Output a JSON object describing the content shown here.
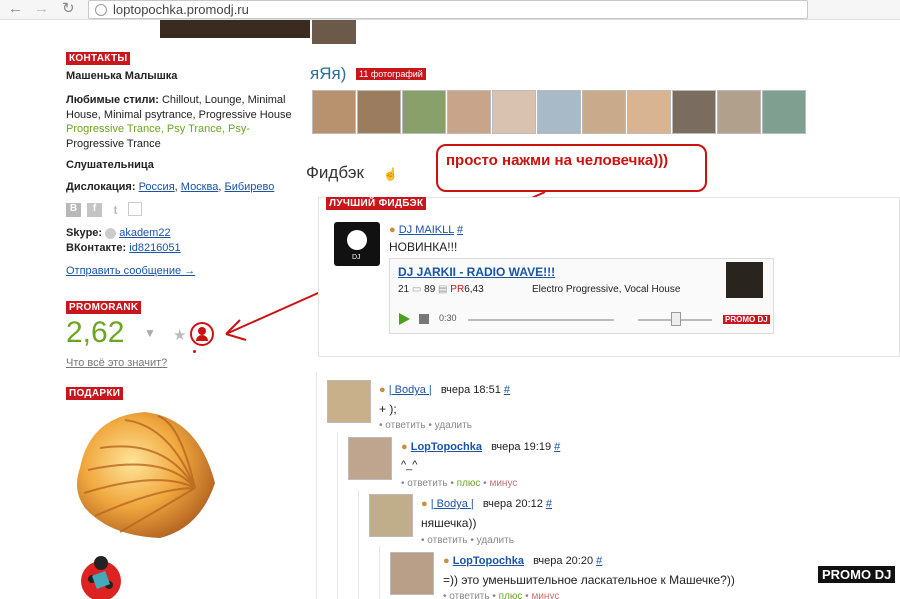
{
  "browser": {
    "back": "←",
    "forward": "→",
    "reload": "↻",
    "url": "loptopochka.promodj.ru"
  },
  "left": {
    "contacts_label": "КОНТАКТЫ",
    "name": "Машенька Малышка",
    "styles_label": "Любимые стили:",
    "styles_line1": "Chillout, Lounge, Minimal",
    "styles_line2": "House, Minimal psytrance, Progressive House",
    "styles_line3": "Progressive Trance, Psy Trance, Psy-",
    "styles_line4": "Progressive Trance",
    "role": "Слушательница",
    "location_label": "Дислокация:",
    "location_country": "Россия",
    "location_city": "Москва",
    "location_district": "Бибирево",
    "skype_label": "Skype:",
    "skype_value": "akadem22",
    "vk_label": "ВКонтакте:",
    "vk_value": "id8216051",
    "send_message": "Отправить сообщение →",
    "promorank_label": "PROMORANK",
    "promorank_value": "2,62",
    "promorank_help": "Что всё это значит?",
    "gifts_label": "ПОДАРКИ"
  },
  "right": {
    "album_title": "яЯя)",
    "album_count": "11 фотографий",
    "feedback_title": "Фидбэк",
    "best_feedback_label": "ЛУЧШИЙ ФИДБЭК",
    "best_author": "DJ MAIKLL",
    "best_hash": "#",
    "best_text": "НОВИНКА!!!",
    "track_title": "DJ JARKII - RADIO WAVE!!!",
    "track_plays": "21",
    "track_comments": "89",
    "track_pr": "PR",
    "track_pr_value": "6,43",
    "track_genre": "Electro Progressive, Vocal House",
    "player_time": "0:30",
    "player_logo": "PROMO DJ"
  },
  "comments": [
    {
      "author": "| Bodya |",
      "time": "вчера 18:51",
      "hash": "#",
      "text": "+ );",
      "reply": "ответить",
      "delete": "удалить"
    },
    {
      "author": "LopTopochka",
      "time": "вчера 19:19",
      "hash": "#",
      "text": "^_^",
      "reply": "ответить",
      "plus": "плюс",
      "minus": "минус"
    },
    {
      "author": "| Bodya |",
      "time": "вчера 20:12",
      "hash": "#",
      "text": "няшечка))",
      "reply": "ответить",
      "delete": "удалить"
    },
    {
      "author": "LopTopochka",
      "time": "вчера 20:20",
      "hash": "#",
      "text": "=)) это уменьшительное ласкательное к Машечке?))",
      "reply": "ответить",
      "plus": "плюс",
      "minus": "минус"
    }
  ],
  "annotation": "просто нажми на человечка)))",
  "watermark": "PROMO DJ",
  "colors": {
    "brand_red": "#c8161c",
    "link_blue": "#1a53a8",
    "rank_green": "#6aa620",
    "annotation_red": "#cc1111"
  }
}
